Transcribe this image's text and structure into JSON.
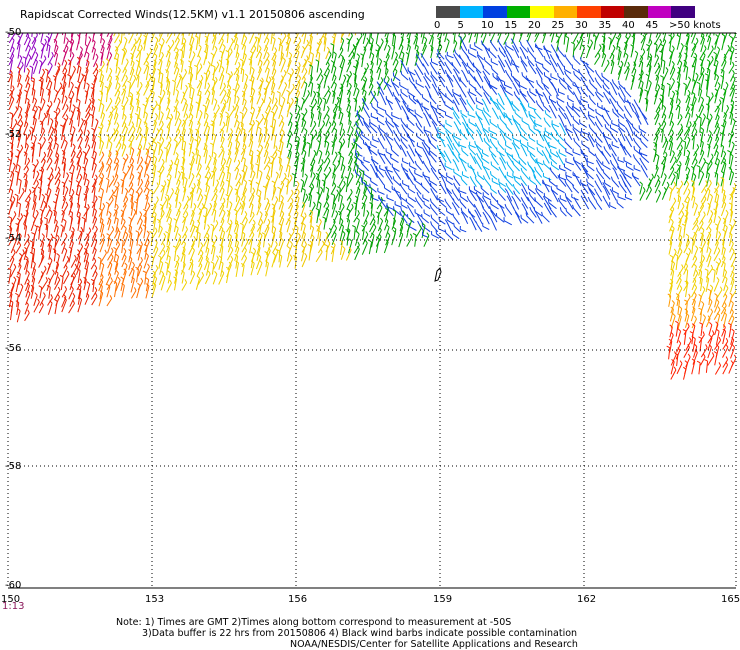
{
  "title": "Rapidscat Corrected Winds(12.5KM) v1.1 20150806 ascending",
  "legend": {
    "colors": [
      "#4a4a4a",
      "#00b4ff",
      "#0040e0",
      "#00b000",
      "#ffff00",
      "#ffb000",
      "#ff4000",
      "#c00000",
      "#5a2a0a",
      "#c000c0",
      "#400080"
    ],
    "labels": [
      "0",
      "5",
      "10",
      "15",
      "20",
      "25",
      "30",
      "35",
      "40",
      "45",
      ">50 knots"
    ]
  },
  "map": {
    "lat_labels": [
      "-50",
      "-52",
      "-54",
      "-56",
      "-58",
      "-60"
    ],
    "lon_labels": [
      "150",
      "153",
      "156",
      "159",
      "162",
      "165"
    ],
    "time_label": "1:13"
  },
  "notes": {
    "line1": "Note: 1) Times are GMT 2)Times along bottom correspond to measurement at -50S",
    "line2": "3)Data buffer is 22 hrs from 20150806 4) Black wind barbs indicate possible contamination",
    "line3": "NOAA/NESDIS/Center for Satellite Applications and Research"
  }
}
